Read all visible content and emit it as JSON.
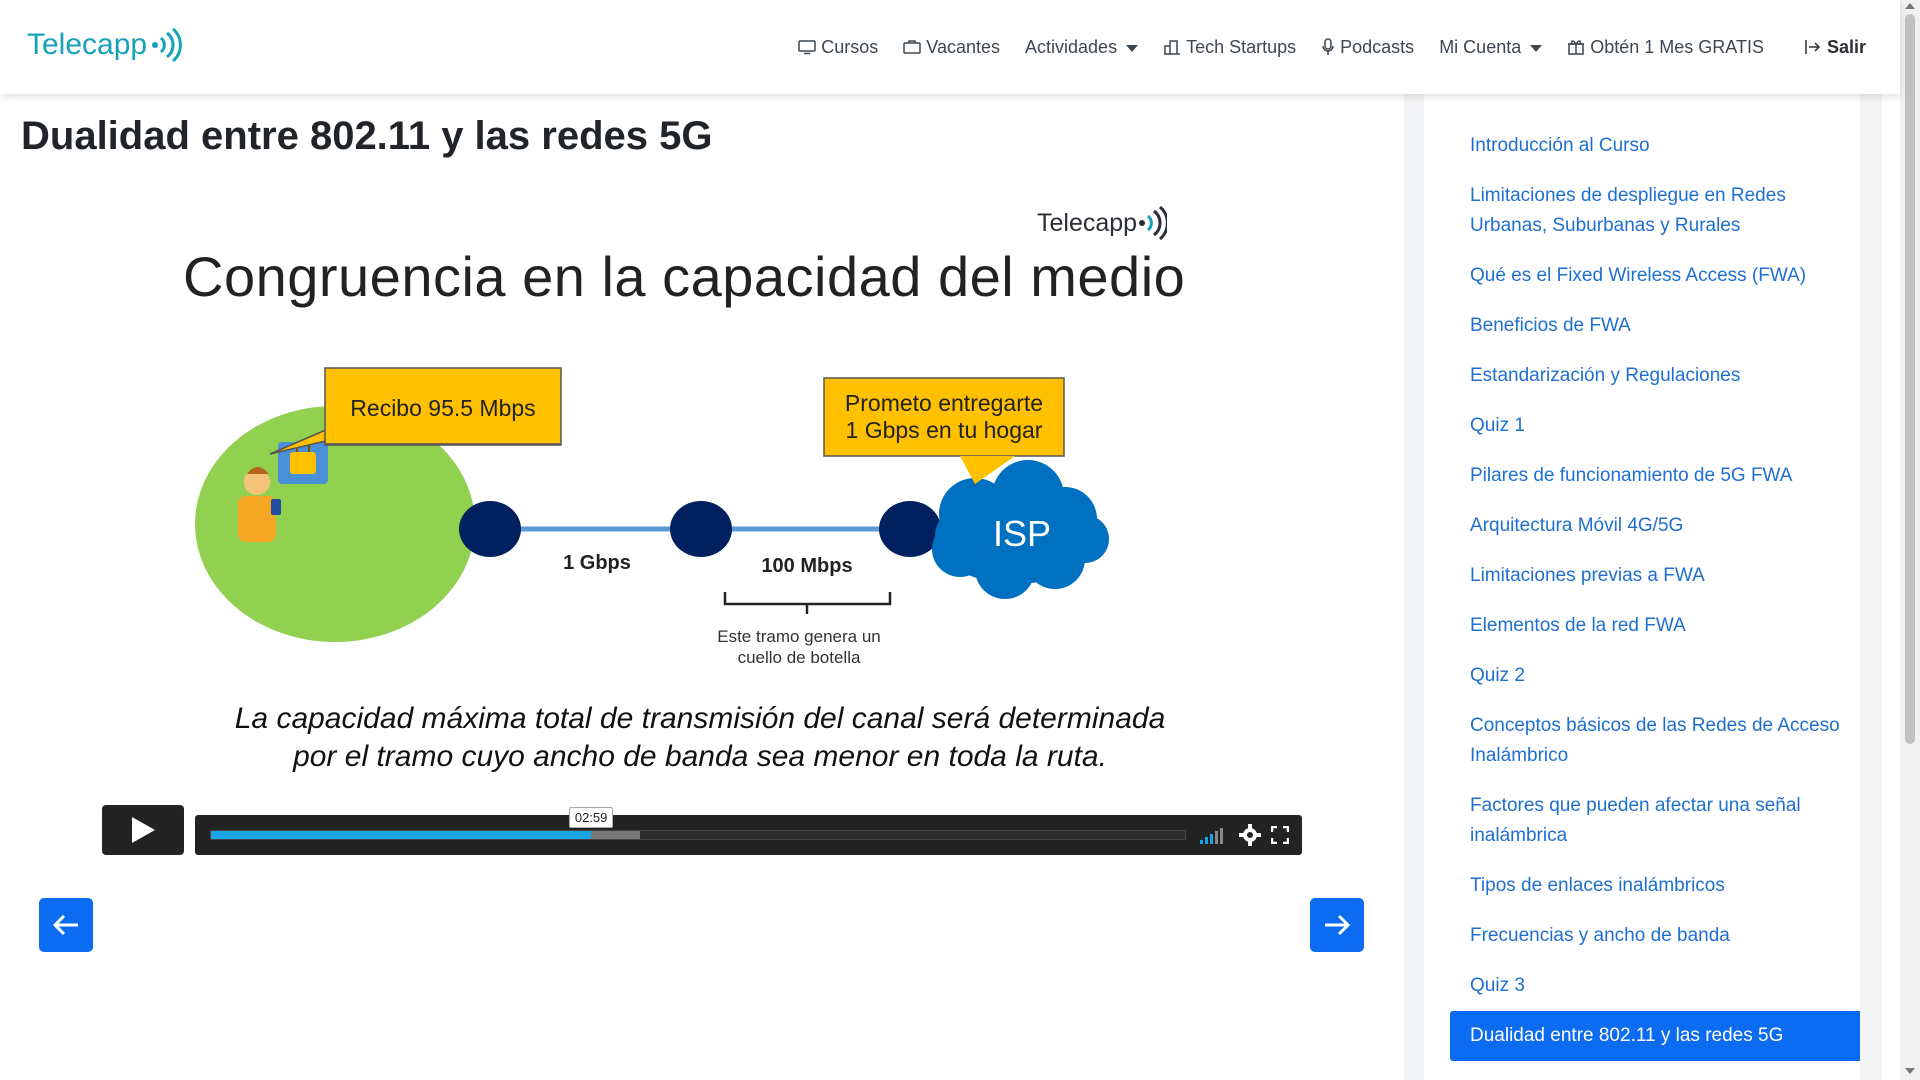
{
  "brand": {
    "name": "Telecapp"
  },
  "nav": {
    "items": [
      {
        "label": "Cursos",
        "icon": "monitor-icon"
      },
      {
        "label": "Vacantes",
        "icon": "briefcase-icon"
      },
      {
        "label": "Actividades",
        "icon": "",
        "dropdown": true
      },
      {
        "label": "Tech Startups",
        "icon": "buildings-icon"
      },
      {
        "label": "Podcasts",
        "icon": "microphone-icon"
      },
      {
        "label": "Mi Cuenta",
        "icon": "",
        "dropdown": true
      },
      {
        "label": "Obtén 1 Mes GRATIS",
        "icon": "gift-icon"
      },
      {
        "label": "Salir",
        "icon": "logout-icon"
      }
    ]
  },
  "page": {
    "title": "Dualidad entre 802.11 y las redes 5G"
  },
  "slide": {
    "logo": "Telecapp",
    "heading": "Congruencia en la capacidad del medio",
    "bubble_left": "Recibo 95.5 Mbps",
    "bubble_right_line1": "Prometo entregarte",
    "bubble_right_line2": "1 Gbps en tu hogar",
    "link1": "1 Gbps",
    "link2": "100 Mbps",
    "bottleneck_line1": "Este tramo genera un",
    "bottleneck_line2": "cuello de botella",
    "isp": "ISP",
    "caption_line1": "La capacidad máxima total de transmisión del canal será determinada",
    "caption_line2": "por el tramo cuyo ancho de banda sea menor en toda la ruta."
  },
  "player": {
    "time": "02:59",
    "progress": 0.39,
    "buffered": 0.44
  },
  "sidebar": {
    "lessons": [
      {
        "label": "Introducción al Curso"
      },
      {
        "label": "Limitaciones de despliegue en Redes Urbanas, Suburbanas y Rurales"
      },
      {
        "label": "Qué es el Fixed Wireless Access (FWA)"
      },
      {
        "label": "Beneficios de FWA"
      },
      {
        "label": "Estandarización y Regulaciones"
      },
      {
        "label": "Quiz 1"
      },
      {
        "label": "Pilares de funcionamiento de 5G FWA"
      },
      {
        "label": "Arquitectura Móvil 4G/5G"
      },
      {
        "label": "Limitaciones previas a FWA"
      },
      {
        "label": "Elementos de la red FWA"
      },
      {
        "label": "Quiz 2"
      },
      {
        "label": "Conceptos básicos de las Redes de Acceso Inalámbrico"
      },
      {
        "label": "Factores que pueden afectar una señal inalámbrica"
      },
      {
        "label": "Tipos de enlaces inalámbricos"
      },
      {
        "label": "Frecuencias y ancho de banda"
      },
      {
        "label": "Quiz 3"
      },
      {
        "label": "Dualidad entre 802.11 y las redes 5G",
        "active": true
      }
    ]
  },
  "colors": {
    "brand": "#16a2b8",
    "primary": "#0b6cf2",
    "link": "#1f6fd1",
    "bubble": "#ffc000",
    "circle": "#92d050",
    "node": "#002060",
    "cloud": "#0070c0"
  }
}
